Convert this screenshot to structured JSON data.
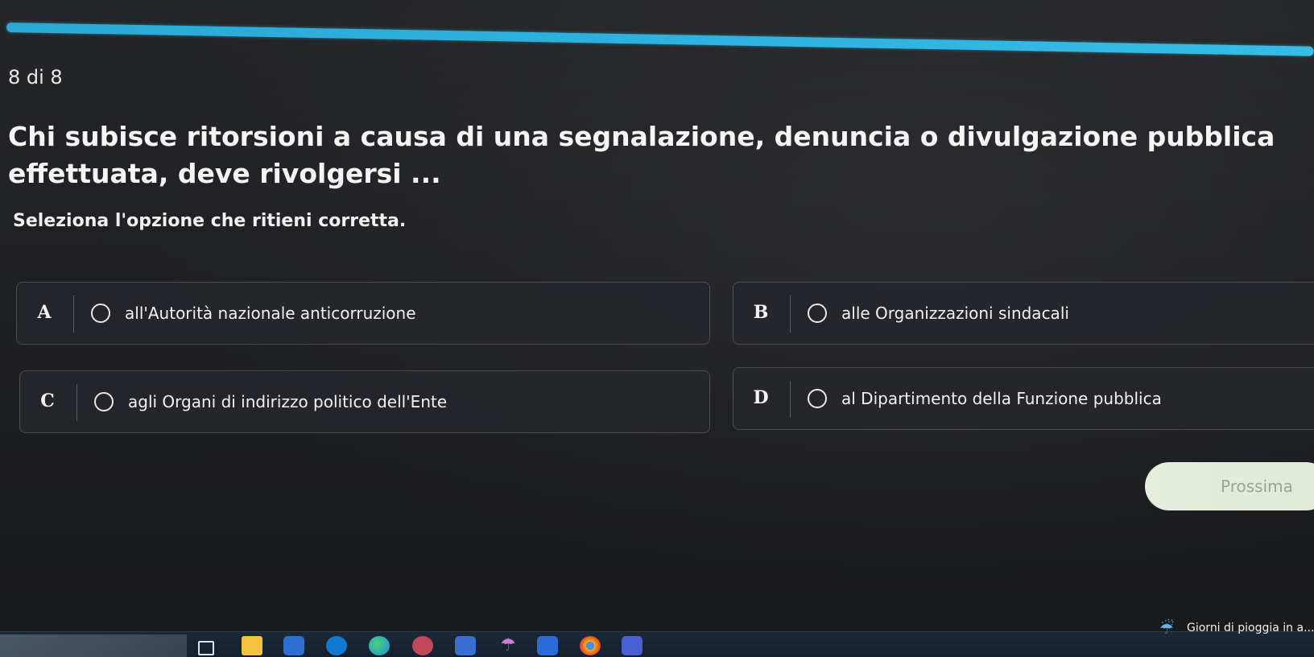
{
  "progress": {
    "counter": "8 di 8",
    "fraction": 1.0,
    "color": "#2fb3e0"
  },
  "question": {
    "text": "Chi subisce ritorsioni a causa di una segnalazione, denuncia o divulgazione pubblica effettuata, deve rivolgersi ...",
    "instruction": "Seleziona l'opzione che ritieni corretta."
  },
  "options": [
    {
      "letter": "A",
      "text": "all'Autorità nazionale anticorruzione"
    },
    {
      "letter": "B",
      "text": "alle Organizzazioni sindacali"
    },
    {
      "letter": "C",
      "text": "agli Organi di indirizzo politico dell'Ente"
    },
    {
      "letter": "D",
      "text": "al Dipartimento della Funzione pubblica"
    }
  ],
  "next_button": {
    "label": "Prossima",
    "background": "#e6efdf"
  },
  "taskbar": {
    "icons": [
      "task-view-icon",
      "file-explorer-icon",
      "store-icon",
      "outlook-icon",
      "edge-icon",
      "app-icon",
      "calculator-icon",
      "umbrella-icon",
      "calendar-icon",
      "chrome-icon",
      "teams-icon"
    ],
    "weather": {
      "icon": "rain-umbrella-icon",
      "text": "Giorni di pioggia in a..."
    }
  },
  "colors": {
    "background": "#1e1f22",
    "accent": "#2fb3e0"
  }
}
